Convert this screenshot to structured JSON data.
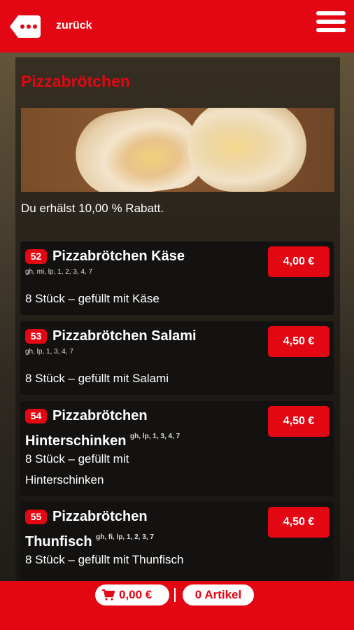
{
  "header": {
    "back_label": "zurück",
    "back_icon": "dots-back-icon",
    "menu_icon": "hamburger-icon"
  },
  "category": {
    "title": "Pizzabrötchen",
    "discount_text": "Du erhälst 10,00 % Rabatt."
  },
  "items": [
    {
      "number": "52",
      "name": "Pizzabrötchen Käse",
      "allergens": "gh, mi, lp, 1, 2, 3, 4, 7",
      "description": "8 Stück – gefüllt mit Käse",
      "price": "4,00 €"
    },
    {
      "number": "53",
      "name": "Pizzabrötchen Salami",
      "allergens": "gh, lp, 1, 3, 4, 7",
      "description": "8 Stück – gefüllt mit Salami",
      "price": "4,50 €"
    },
    {
      "number": "54",
      "name_line1": "Pizzabrötchen",
      "name_line2": "Hinterschinken",
      "allergens": "gh, lp, 1, 3, 4, 7",
      "description_line1": "8 Stück – gefüllt mit",
      "description_line2": "Hinterschinken",
      "price": "4,50 €"
    },
    {
      "number": "55",
      "name_line1": "Pizzabrötchen",
      "name_line2": "Thunfisch",
      "allergens": "gh, fi, lp, 1, 2, 3, 7",
      "description": "8 Stück – gefüllt mit Thunfisch",
      "price": "4,50 €"
    }
  ],
  "cart": {
    "total": "0,00 €",
    "articles": "0 Artikel",
    "cart_icon": "shopping-cart-icon"
  },
  "colors": {
    "brand_red": "#e30613"
  }
}
